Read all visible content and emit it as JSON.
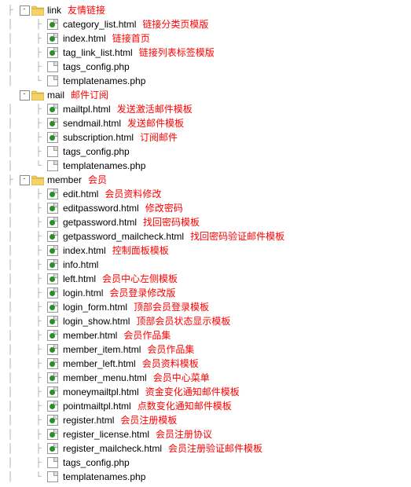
{
  "folders": [
    {
      "name": "link",
      "desc": "友情链接",
      "expander": "-",
      "indent": 1,
      "hasPrefix": true,
      "files": [
        {
          "name": "category_list.html",
          "desc": "链接分类页模版",
          "green": true
        },
        {
          "name": "index.html",
          "desc": "链接首页",
          "green": true
        },
        {
          "name": "tag_link_list.html",
          "desc": "链接列表标签模版",
          "green": true
        },
        {
          "name": "tags_config.php",
          "desc": "",
          "green": false
        },
        {
          "name": "templatenames.php",
          "desc": "",
          "green": false
        }
      ]
    },
    {
      "name": "mail",
      "desc": "邮件订阅",
      "expander": "-",
      "indent": 0,
      "hasPrefix": false,
      "files": [
        {
          "name": "mailtpl.html",
          "desc": "发送激活邮件模板",
          "green": true
        },
        {
          "name": "sendmail.html",
          "desc": "发送邮件模板",
          "green": true
        },
        {
          "name": "subscription.html",
          "desc": "订阅邮件",
          "green": true
        },
        {
          "name": "tags_config.php",
          "desc": "",
          "green": false
        },
        {
          "name": "templatenames.php",
          "desc": "",
          "green": false
        }
      ]
    },
    {
      "name": "member",
      "desc": "会员",
      "expander": "-",
      "indent": 1,
      "hasPrefix": true,
      "files": [
        {
          "name": "edit.html",
          "desc": "会员资料修改",
          "green": true
        },
        {
          "name": "editpassword.html",
          "desc": "修改密码",
          "green": true
        },
        {
          "name": "getpassword.html",
          "desc": "找回密码模板",
          "green": true
        },
        {
          "name": "getpassword_mailcheck.html",
          "desc": "找回密码验证邮件模板",
          "green": true
        },
        {
          "name": "index.html",
          "desc": "控制面板模板",
          "green": true
        },
        {
          "name": "info.html",
          "desc": "",
          "green": true
        },
        {
          "name": "left.html",
          "desc": "会员中心左侧模板",
          "green": true
        },
        {
          "name": "login.html",
          "desc": "会员登录修改版",
          "green": true
        },
        {
          "name": "login_form.html",
          "desc": "顶部会员登录模板",
          "green": true
        },
        {
          "name": "login_show.html",
          "desc": "顶部会员状态显示模板",
          "green": true
        },
        {
          "name": "member.html",
          "desc": "会员作品集",
          "green": true
        },
        {
          "name": "member_item.html",
          "desc": "会员作品集",
          "green": true
        },
        {
          "name": "member_left.html",
          "desc": "会员资料模板",
          "green": true
        },
        {
          "name": "member_menu.html",
          "desc": "会员中心菜单",
          "green": true
        },
        {
          "name": "moneymailtpl.html",
          "desc": "资金变化通知邮件模板",
          "green": true
        },
        {
          "name": "pointmailtpl.html",
          "desc": "点数变化通知邮件模板",
          "green": true
        },
        {
          "name": "register.html",
          "desc": "会员注册模板",
          "green": true
        },
        {
          "name": "register_license.html",
          "desc": "会员注册协议",
          "green": true
        },
        {
          "name": "register_mailcheck.html",
          "desc": "会员注册验证邮件模板",
          "green": true
        },
        {
          "name": "tags_config.php",
          "desc": "",
          "green": false
        },
        {
          "name": "templatenames.php",
          "desc": "",
          "green": false
        }
      ]
    }
  ]
}
